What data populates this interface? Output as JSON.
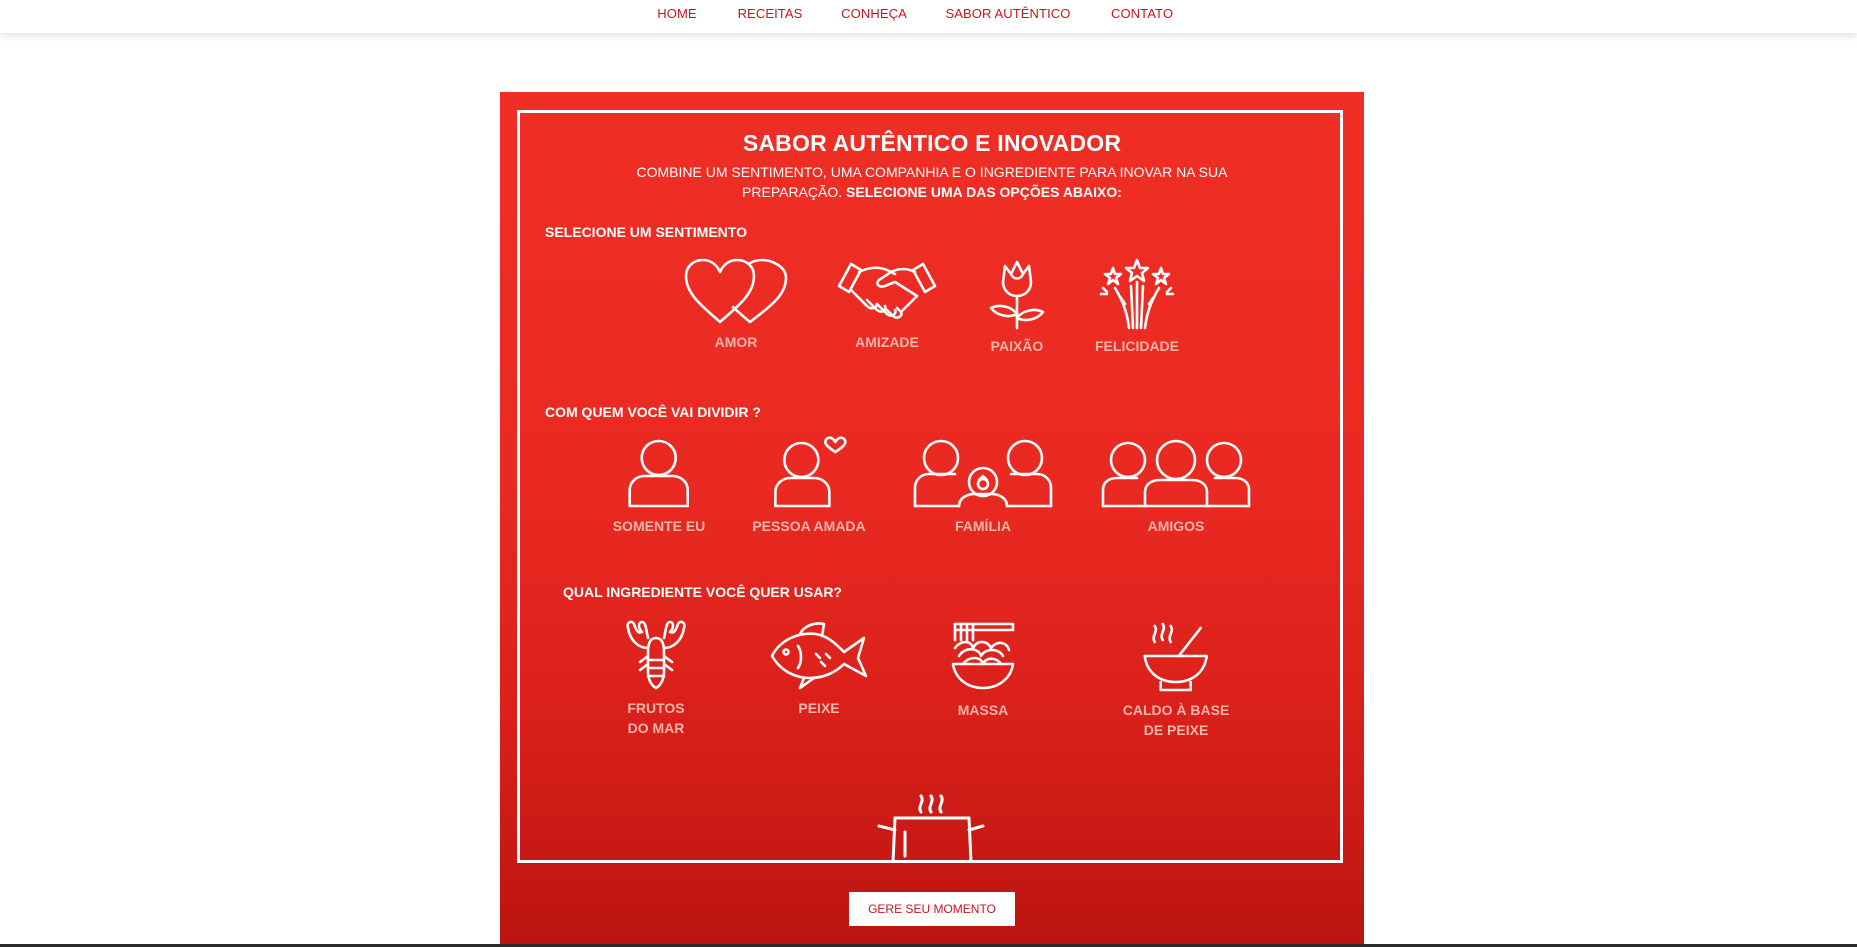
{
  "nav": {
    "items": [
      "HOME",
      "RECEITAS",
      "CONHEÇA",
      "SABOR AUTÊNTICO",
      "CONTATO"
    ]
  },
  "main": {
    "title": "SABOR AUTÊNTICO E INOVADOR",
    "subtitle_line1": "COMBINE UM SENTIMENTO, UMA COMPANHIA E O INGREDIENTE PARA INOVAR NA SUA",
    "subtitle_line2": "PREPARAÇÃO.",
    "subtitle_bold": "SELECIONE UMA DAS OPÇÕES ABAIXO:",
    "sentimento": {
      "label": "SELECIONE UM SENTIMENTO",
      "options": [
        {
          "label": "AMOR",
          "icon": "hearts-icon"
        },
        {
          "label": "AMIZADE",
          "icon": "handshake-icon"
        },
        {
          "label": "PAIXÃO",
          "icon": "rose-icon"
        },
        {
          "label": "FELICIDADE",
          "icon": "fireworks-icon"
        }
      ]
    },
    "companhia": {
      "label": "COM QUEM VOCÊ VAI DIVIDIR ?",
      "options": [
        {
          "label": "SOMENTE EU",
          "icon": "person-icon"
        },
        {
          "label": "PESSOA AMADA",
          "icon": "person-heart-icon"
        },
        {
          "label": "FAMÍLIA",
          "icon": "family-icon"
        },
        {
          "label": "AMIGOS",
          "icon": "friends-icon"
        }
      ]
    },
    "ingrediente": {
      "label": "QUAL INGREDIENTE VOCÊ QUER USAR?",
      "options": [
        {
          "line1": "FRUTOS",
          "line2": "DO MAR",
          "icon": "lobster-icon"
        },
        {
          "line1": "PEIXE",
          "line2": "",
          "icon": "fish-icon"
        },
        {
          "line1": "MASSA",
          "line2": "",
          "icon": "pasta-icon"
        },
        {
          "line1": "CALDO À BASE",
          "line2": "DE PEIXE",
          "icon": "soup-bowl-icon"
        }
      ]
    },
    "pot_icon": "cooking-pot-icon",
    "button": "GERE SEU MOMENTO"
  },
  "colors": {
    "brand_red": "#c8161d",
    "panel_top": "#ef2e25",
    "panel_bottom": "#bb1410",
    "option_label": "#f7b5ad"
  }
}
